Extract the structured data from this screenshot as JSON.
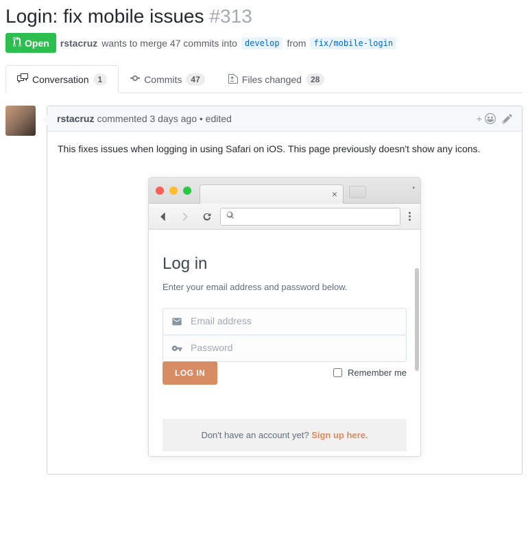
{
  "pr": {
    "title": "Login: fix mobile issues",
    "number": "#313",
    "status": "Open",
    "author": "rstacruz",
    "merge_text": "wants to merge 47 commits into",
    "base_branch": "develop",
    "from_text": "from",
    "head_branch": "fix/mobile-login"
  },
  "tabs": {
    "conversation": {
      "label": "Conversation",
      "count": "1"
    },
    "commits": {
      "label": "Commits",
      "count": "47"
    },
    "files": {
      "label": "Files changed",
      "count": "28"
    }
  },
  "comment": {
    "author": "rstacruz",
    "meta": "commented 3 days ago • edited",
    "body": "This fixes issues when logging in using Safari on iOS. This page previously doesn't show any icons."
  },
  "mock": {
    "login_title": "Log in",
    "login_subtitle": "Enter your email address and password below.",
    "email_placeholder": "Email address",
    "password_placeholder": "Password",
    "login_button": "LOG IN",
    "remember_label": "Remember me",
    "signup_prompt": "Don't have an account yet? ",
    "signup_link": "Sign up here."
  }
}
